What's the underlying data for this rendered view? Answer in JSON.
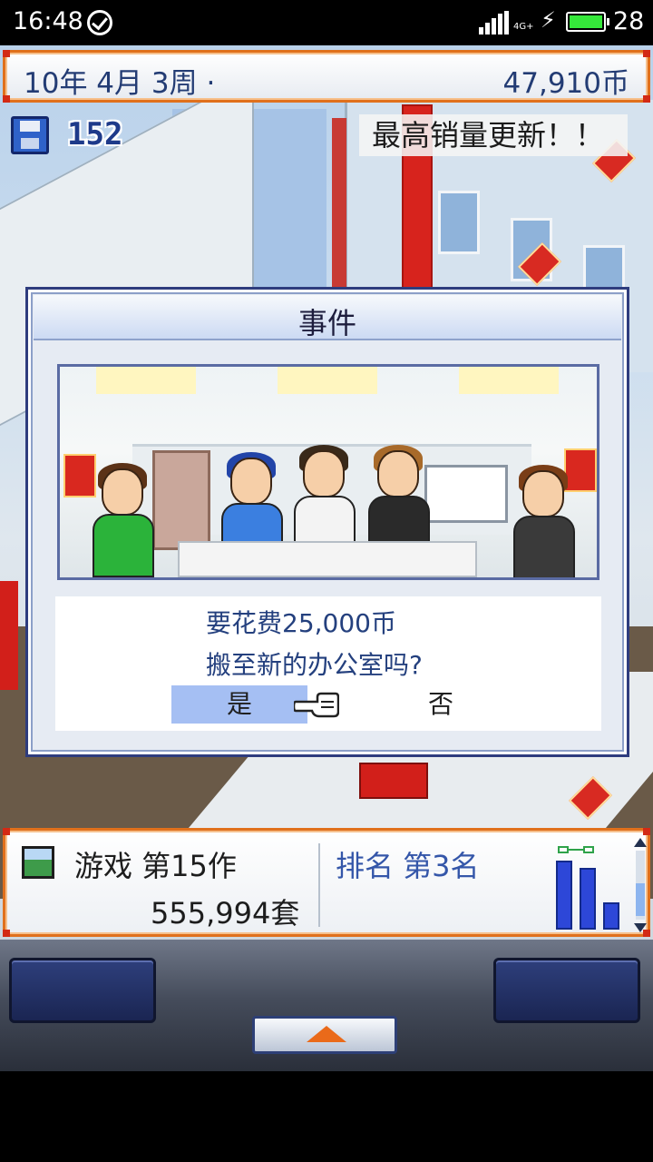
{
  "status_bar": {
    "time": "16:48",
    "network": "4G+",
    "battery_level": "28",
    "battery_color": "#35e83a"
  },
  "top_bar": {
    "date": "10年 4月 3周 ·",
    "money": "47,910币"
  },
  "save": {
    "count": "152",
    "icon": "floppy-disk-icon"
  },
  "notice": {
    "text": "最高销量更新！！"
  },
  "event_dialog": {
    "title": "事件",
    "line1": "要花费25,000币",
    "line2": "搬至新的办公室吗?",
    "yes_label": "是",
    "no_label": "否",
    "selected": "是",
    "pointer_icon": "hand-pointer-icon"
  },
  "bottom_panel": {
    "game_label": "游戏 第15作",
    "sales": "555,994套",
    "rank_label": "排名 第3名",
    "accent_color": "#3456a9",
    "chart_icon": "sales-bar-chart-icon"
  },
  "controls": {
    "menu_icon": "up-arrow-icon"
  },
  "colors": {
    "frame_orange": "#e0701c",
    "dialog_border": "#2e3c7e",
    "selected_option": "#a5bff3"
  }
}
